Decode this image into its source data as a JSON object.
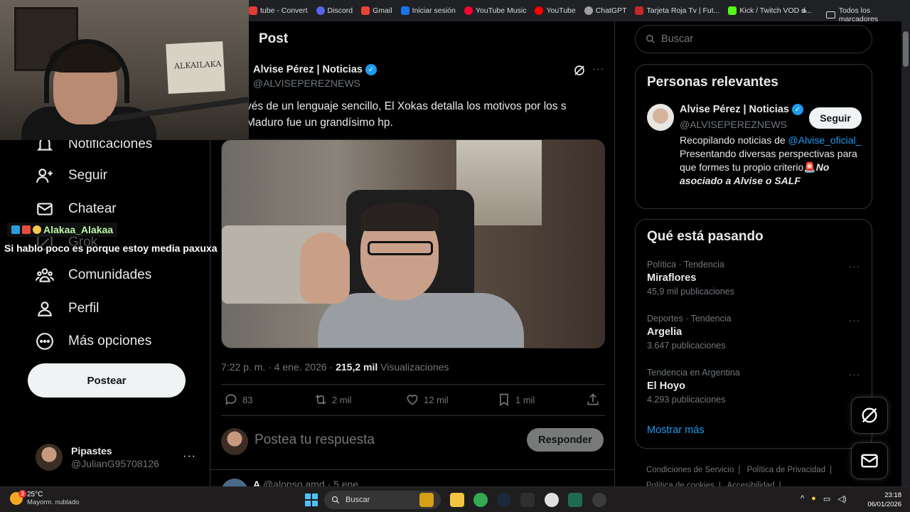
{
  "bookmarks": {
    "items": [
      {
        "label": "tube - Convert",
        "color": "#e53935"
      },
      {
        "label": "Discord",
        "color": "#5865f2"
      },
      {
        "label": "Gmail",
        "color": "#ea4335"
      },
      {
        "label": "Iniciar sesión",
        "color": "#1a73e8"
      },
      {
        "label": "YouTube Music",
        "color": "#ff0033"
      },
      {
        "label": "YouTube",
        "color": "#ff0000"
      },
      {
        "label": "ChatGPT",
        "color": "#9e9e9e"
      },
      {
        "label": "Tarjeta Roja Tv | Fut...",
        "color": "#c62828"
      },
      {
        "label": "Kick / Twitch VOD d...",
        "color": "#53fc18"
      }
    ],
    "more": "»",
    "all_label": "Todos los marcadores"
  },
  "webcam": {
    "poster_text": "ALKAILAKA"
  },
  "nav": {
    "items": [
      {
        "label": "Notificaciones",
        "icon": "bell-icon"
      },
      {
        "label": "Seguir",
        "icon": "follow-icon"
      },
      {
        "label": "Chatear",
        "icon": "mail-icon"
      },
      {
        "label": "Grok",
        "icon": "grok-icon"
      },
      {
        "label": "Comunidades",
        "icon": "communities-icon"
      },
      {
        "label": "Perfil",
        "icon": "profile-icon"
      },
      {
        "label": "Más opciones",
        "icon": "more-icon"
      }
    ],
    "post_button": "Postear",
    "account": {
      "name": "Pipastes",
      "handle": "@JulianG95708126",
      "more": "···"
    }
  },
  "chat": {
    "username": "Alakaa_Alakaa",
    "badge_colors": [
      "#2d9cdb",
      "#e74c3c",
      "#f2c94c"
    ],
    "message": "Si hablo poco es porque estoy media paxuxa"
  },
  "post": {
    "header_title": "Post",
    "author_name": "Alvise Pérez | Noticias",
    "author_handle": "@ALVISEPEREZNEWS",
    "more": "···",
    "text": "vés de un lenguaje sencillo, El Xokas detalla los motivos por los s Maduro fue un grandísimo hp.",
    "time": "7:22 p. m. · 4 ene. 2026 · ",
    "views_count": "215,2 mil",
    "views_label": " Visualizaciones",
    "actions": {
      "replies": "83",
      "reposts": "2 mil",
      "likes": "12 mil",
      "bookmarks": "1 mil"
    },
    "reply_placeholder": "Postea tu respuesta",
    "reply_button": "Responder",
    "next_name": "A",
    "next_handle": "@alonso.amd · 5 ene"
  },
  "sidebar": {
    "search_placeholder": "Buscar",
    "relevant": {
      "title": "Personas relevantes",
      "name": "Alvise Pérez | Noticias",
      "handle": "@ALVISEPEREZNEWS",
      "follow": "Seguir",
      "bio_prefix": "Recopilando noticias de ",
      "bio_link": "@Alvise_oficial_",
      "bio_mid": " Presentando diversas perspectivas para que formes tu propio criterio",
      "bio_emoji": "🚨",
      "bio_bold": "No asociado a Alvise o SALF"
    },
    "trends": {
      "title": "Qué está pasando",
      "items": [
        {
          "category": "Política · Tendencia",
          "name": "Miraflores",
          "count": "45,9 mil publicaciones"
        },
        {
          "category": "Deportes · Tendencia",
          "name": "Argelia",
          "count": "3.647 publicaciones"
        },
        {
          "category": "Tendencia en Argentina",
          "name": "El Hoyo",
          "count": "4.293 publicaciones"
        }
      ],
      "show_more": "Mostrar más"
    },
    "footer": [
      "Condiciones de Servicio",
      "|",
      "Política de Privacidad",
      "|",
      "Política de cookies",
      "|",
      "Accesibilidad",
      "|"
    ]
  },
  "taskbar": {
    "weather_temp": "25°C",
    "weather_desc": "Mayorm. nublado",
    "weather_badge": "3",
    "search_label": "Buscar",
    "time": "23:18",
    "date": "06/01/2026",
    "tray_chevron": "^"
  }
}
